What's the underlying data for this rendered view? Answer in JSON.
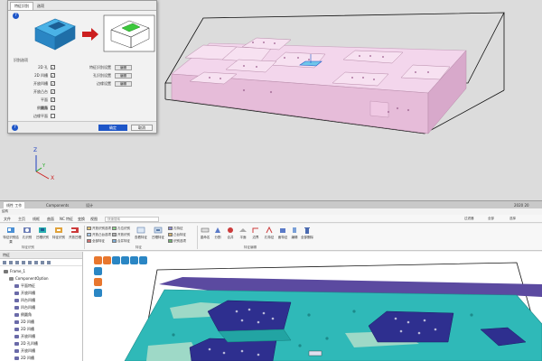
{
  "dialog": {
    "tabs": [
      "特征识别",
      "选项"
    ],
    "group_label": "识别选项",
    "options_left": [
      {
        "label": "2D 孔",
        "checked": true
      },
      {
        "label": "2D 凹槽",
        "checked": true
      },
      {
        "label": "开放凹槽",
        "checked": true
      },
      {
        "label": "开放凸台",
        "checked": true
      },
      {
        "label": "平面",
        "checked": true
      },
      {
        "label": "侧面",
        "checked": false
      },
      {
        "label": "倒圆角",
        "checked": true
      },
      {
        "label": "边缘平面",
        "checked": false
      }
    ],
    "options_right": [
      {
        "label": "特征识别设置",
        "button": "编辑"
      },
      {
        "label": "孔识别设置",
        "button": "编辑"
      },
      {
        "label": "边缘设置",
        "button": "编辑"
      }
    ],
    "ok_label": "确定",
    "cancel_label": "取消"
  },
  "top_tabs": [
    "线性 工作",
    "Components",
    "设计"
  ],
  "axis": {
    "x": "X",
    "y": "Y",
    "z": "Z"
  },
  "status_right": "2020 20",
  "title_row": "结构",
  "menu": [
    "文件",
    "主页",
    "线框",
    "曲面",
    "NC 特征",
    "变换",
    "视图",
    "机床"
  ],
  "search_placeholder": "快速搜索",
  "right_mini": [
    "过滤器",
    "全部",
    "选择"
  ],
  "ribbon": {
    "buttons": [
      {
        "label": "特征识别结果"
      },
      {
        "label": "孔识别"
      },
      {
        "label": "凹槽识别"
      },
      {
        "label": "特征识别"
      },
      {
        "label": "开放凹槽"
      }
    ],
    "small": [
      "开放识别选项",
      "开放凸台选项",
      "全部特征",
      "孔位识别",
      "开放识别",
      "合并特征"
    ],
    "small2": [
      "查看特征",
      "凹槽特征",
      "孔特征",
      "凸台特征",
      "识别选项"
    ],
    "tools": [
      "重命名",
      "分割",
      "合并",
      "平面",
      "边界",
      "孔特征",
      "面特征",
      "编辑",
      "全部删除"
    ],
    "groups": [
      "特征识别",
      "特征",
      "特征编辑"
    ]
  },
  "tree": {
    "title": "特征",
    "items": [
      "Frame_1",
      "ComponentOption",
      "平面特征",
      "开放凹槽",
      "凹台凹槽",
      "凹台凹槽",
      "倒圆角",
      "2D 凹槽",
      "2D 凹槽",
      "开放凹槽",
      "2D 孔凹槽",
      "开放凹槽",
      "2D 凹槽"
    ]
  },
  "colors": {
    "plate_pink": "#f3d6ec",
    "plate_cyan": "#2fb9b8",
    "pocket_navy": "#2e2f8f",
    "accent_blue": "#1e56c8",
    "purple_band": "#5b4aa0"
  }
}
